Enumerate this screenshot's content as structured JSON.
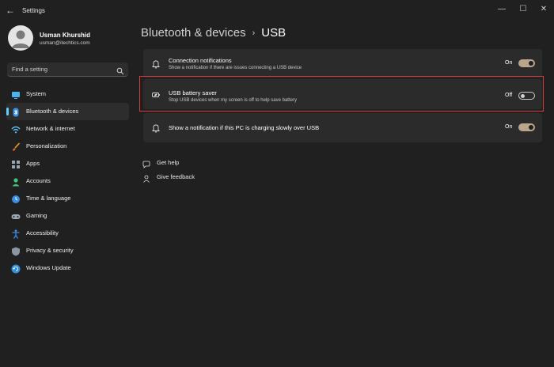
{
  "app": {
    "title": "Settings"
  },
  "profile": {
    "name": "Usman Khurshid",
    "email": "usman@itechtics.com"
  },
  "search": {
    "placeholder": "Find a setting"
  },
  "sidebar": {
    "items": [
      {
        "label": "System",
        "icon": "monitor-icon"
      },
      {
        "label": "Bluetooth & devices",
        "icon": "bluetooth-icon",
        "selected": true
      },
      {
        "label": "Network & internet",
        "icon": "wifi-icon"
      },
      {
        "label": "Personalization",
        "icon": "brush-icon"
      },
      {
        "label": "Apps",
        "icon": "apps-icon"
      },
      {
        "label": "Accounts",
        "icon": "person-icon"
      },
      {
        "label": "Time & language",
        "icon": "globe-clock-icon"
      },
      {
        "label": "Gaming",
        "icon": "gamepad-icon"
      },
      {
        "label": "Accessibility",
        "icon": "accessibility-icon"
      },
      {
        "label": "Privacy & security",
        "icon": "shield-icon"
      },
      {
        "label": "Windows Update",
        "icon": "update-icon"
      }
    ]
  },
  "breadcrumb": {
    "parent": "Bluetooth & devices",
    "separator": "›",
    "current": "USB"
  },
  "settings": [
    {
      "title": "Connection notifications",
      "subtitle": "Show a notification if there are issues connecting a USB device",
      "state": "On",
      "icon": "bell-icon"
    },
    {
      "title": "USB battery saver",
      "subtitle": "Stop USB devices when my screen is off to help save battery",
      "state": "Off",
      "icon": "battery-leaf-icon"
    },
    {
      "title": "Show a notification if this PC is charging slowly over USB",
      "state": "On",
      "icon": "bell-icon"
    }
  ],
  "links": {
    "help": "Get help",
    "feedback": "Give feedback"
  },
  "colors": {
    "accent": "#60cdff",
    "toggle_on": "#b9a58a",
    "highlight": "#d93a3a",
    "background": "#202020",
    "card": "#2b2b2b"
  }
}
